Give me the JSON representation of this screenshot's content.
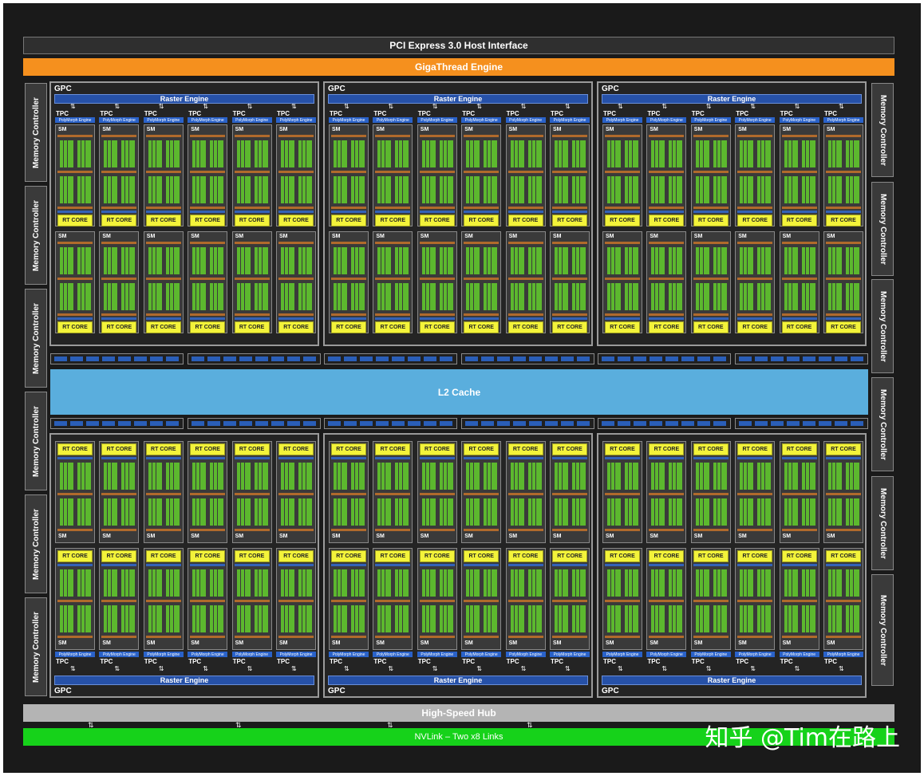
{
  "diagram": {
    "pci_label": "PCI Express 3.0 Host Interface",
    "gigathread_label": "GigaThread Engine",
    "l2_label": "L2 Cache",
    "hub_label": "High-Speed Hub",
    "nvlink_label": "NVLink – Two x8 Links",
    "memory_controller_label": "Memory Controller",
    "gpc_label": "GPC",
    "raster_label": "Raster Engine",
    "tpc_label": "TPC",
    "polymorph_label": "PolyMorph Engine",
    "sm_label": "SM",
    "rt_core_label": "RT CORE"
  },
  "watermark": "知乎 @Tim在路上",
  "colors": {
    "gigathread": "#f5901e",
    "nvlink": "#16d21a",
    "l2": "#5aaedd",
    "hub": "#b4b4b4",
    "raster": "#2651a8",
    "rt_core": "#f3f33a",
    "cuda_core": "#5cb82e"
  }
}
